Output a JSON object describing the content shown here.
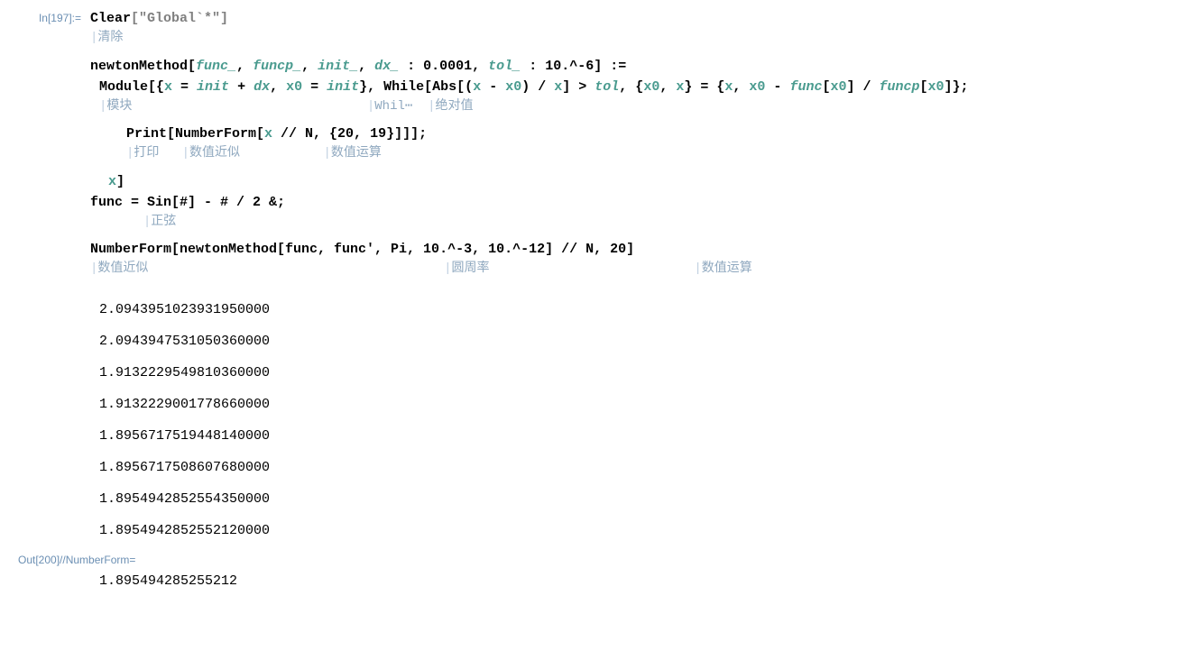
{
  "in_label": "In[197]:=",
  "out_label": "Out[200]//NumberForm=",
  "code": {
    "line1": {
      "clear": "Clear",
      "arg": "[\"Global`*\"]"
    },
    "annot1": {
      "text": "清除"
    },
    "line2": {
      "p1": "newtonMethod[",
      "a1": "func_",
      "p2": ", ",
      "a2": "funcp_",
      "p3": ", ",
      "a3": "init_",
      "p4": ", ",
      "a4": "dx_",
      "p5": " : 0.0001, ",
      "a5": "tol_",
      "p6": " : 10.^-6] :="
    },
    "line3": {
      "p1": "Module[{",
      "v1": "x",
      "p2": " = ",
      "a1": "init",
      "p3": " + ",
      "a2": "dx",
      "p4": ", ",
      "v2": "x0",
      "p5": " = ",
      "a3": "init",
      "p6": "}, While[Abs[(",
      "v3": "x",
      "p7": " - ",
      "v4": "x0",
      "p8": ") / ",
      "v5": "x",
      "p9": "] > ",
      "a4": "tol",
      "p10": ", {",
      "v6": "x0",
      "p11": ", ",
      "v7": "x",
      "p12": "} = {",
      "v8": "x",
      "p13": ", ",
      "v9": "x0",
      "p14": " - ",
      "a5": "func",
      "p15": "[",
      "v10": "x0",
      "p16": "] / ",
      "a6": "funcp",
      "p17": "[",
      "v11": "x0",
      "p18": "]};"
    },
    "annot3a": "模块",
    "annot3b": "Whil⋯",
    "annot3c": "绝对值",
    "line4": {
      "p1": "Print[NumberForm[",
      "v1": "x",
      "p2": " // N, {20, 19}]]];"
    },
    "annot4a": "打印",
    "annot4b": "数值近似",
    "annot4c": "数值运算",
    "line5": {
      "v1": "x",
      "p1": "]"
    },
    "line6": {
      "p1": "func = Sin[#] - # / 2 &;"
    },
    "annot6": "正弦",
    "line7": {
      "p1": "NumberForm[newtonMethod[func, func', Pi, 10.^-3, 10.^-12] // N, 20]"
    },
    "annot7a": "数值近似",
    "annot7b": "圆周率",
    "annot7c": "数值运算"
  },
  "outputs": [
    "2.0943951023931950000",
    "2.0943947531050360000",
    "1.9132229549810360000",
    "1.9132229001778660000",
    "1.8956717519448140000",
    "1.8956717508607680000",
    "1.8954942852554350000",
    "1.8954942852552120000"
  ],
  "final": "1.895494285255212"
}
